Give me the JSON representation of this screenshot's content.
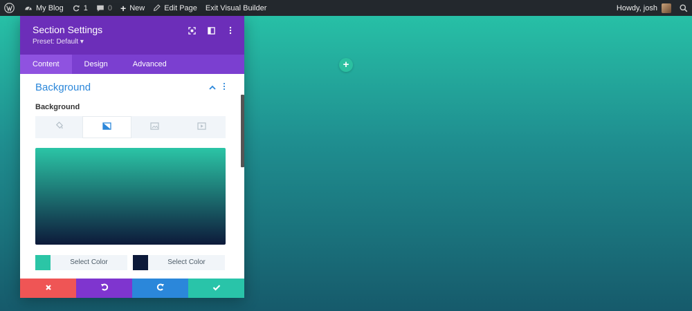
{
  "adminbar": {
    "site_name": "My Blog",
    "updates_count": "1",
    "comments_count": "0",
    "new_label": "New",
    "edit_page_label": "Edit Page",
    "exit_builder_label": "Exit Visual Builder",
    "greeting": "Howdy, josh"
  },
  "panel": {
    "title": "Section Settings",
    "preset": "Preset: Default ▾",
    "tabs": [
      {
        "label": "Content",
        "active": true
      },
      {
        "label": "Design",
        "active": false
      },
      {
        "label": "Advanced",
        "active": false
      }
    ],
    "section_title": "Background",
    "field_label": "Background",
    "background_types": [
      {
        "icon": "paint-bucket-icon",
        "active": false
      },
      {
        "icon": "gradient-icon",
        "active": true
      },
      {
        "icon": "image-icon",
        "active": false
      },
      {
        "icon": "video-icon",
        "active": false
      }
    ],
    "gradient": {
      "start": "#2bc5a6",
      "end": "#0d1a3a"
    },
    "color_pickers": [
      {
        "swatch": "#2bc5a6",
        "label": "Select Color"
      },
      {
        "swatch": "#0d1a3a",
        "label": "Select Color"
      }
    ]
  },
  "footer": {
    "buttons": [
      {
        "icon": "close-icon",
        "color": "#ef5555"
      },
      {
        "icon": "undo-icon",
        "color": "#7f35cf"
      },
      {
        "icon": "redo-icon",
        "color": "#2b87da"
      },
      {
        "icon": "check-icon",
        "color": "#29c4a9"
      }
    ]
  },
  "colors": {
    "accent_purple": "#6c2eb9",
    "accent_blue": "#2b87da",
    "page_gradient_top": "#28c6a9",
    "page_gradient_bottom": "#165a6b"
  }
}
